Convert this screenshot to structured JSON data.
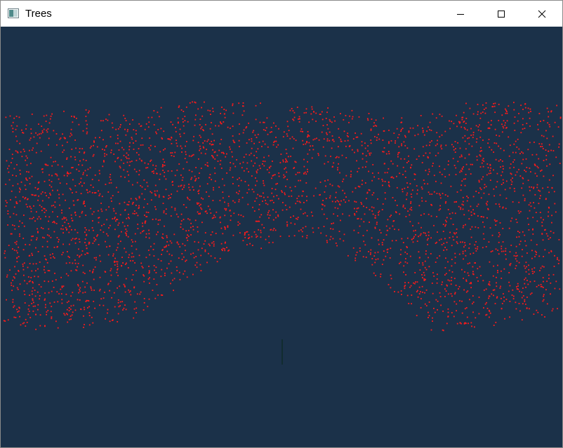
{
  "window": {
    "title": "Trees"
  },
  "icons": {
    "app": "app-window-icon",
    "minimize": "minimize-icon",
    "maximize": "maximize-icon",
    "close": "close-icon"
  },
  "colors": {
    "background": "#1b3149",
    "leaf": "#ff1a1a",
    "trunk": "#0b2a1f",
    "titlebar": "#ffffff"
  }
}
